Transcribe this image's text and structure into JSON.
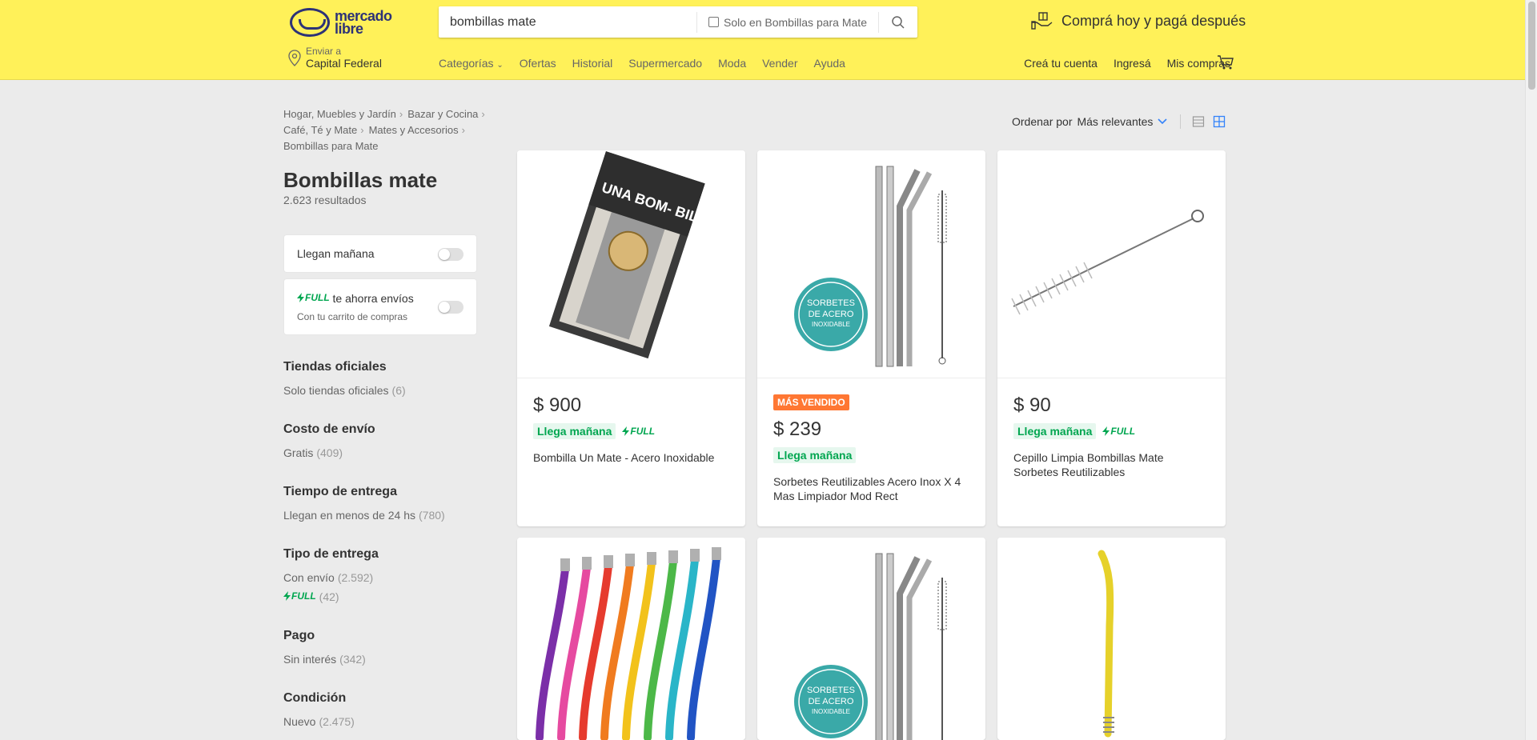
{
  "header": {
    "logo_text": "mercado libre",
    "search_value": "bombillas mate",
    "search_scope": "Solo en Bombillas para Mate",
    "promo": "Comprá hoy y pagá después",
    "location_label": "Enviar a",
    "location_value": "Capital Federal",
    "nav": [
      "Categorías",
      "Ofertas",
      "Historial",
      "Supermercado",
      "Moda",
      "Vender",
      "Ayuda"
    ],
    "user_nav": [
      "Creá tu cuenta",
      "Ingresá",
      "Mis compras"
    ],
    "colors": {
      "brand_yellow": "#fff159",
      "logo_blue": "#2d3277"
    }
  },
  "breadcrumb": [
    "Hogar, Muebles y Jardín",
    "Bazar y Cocina",
    "Café, Té y Mate",
    "Mates y Accesorios",
    "Bombillas para Mate"
  ],
  "page": {
    "title": "Bombillas mate",
    "results": "2.623 resultados"
  },
  "filters": {
    "llegan_manana": "Llegan mañana",
    "full_label": "FULL",
    "full_text": "te ahorra envíos",
    "full_sub": "Con tu carrito de compras"
  },
  "facets": [
    {
      "title": "Tiendas oficiales",
      "options": [
        {
          "label": "Solo tiendas oficiales",
          "qty": "(6)"
        }
      ]
    },
    {
      "title": "Costo de envío",
      "options": [
        {
          "label": "Gratis",
          "qty": "(409)"
        }
      ]
    },
    {
      "title": "Tiempo de entrega",
      "options": [
        {
          "label": "Llegan en menos de 24 hs",
          "qty": "(780)"
        }
      ]
    },
    {
      "title": "Tipo de entrega",
      "options": [
        {
          "label": "Con envío",
          "qty": "(2.592)"
        },
        {
          "label": "FULL",
          "qty": "(42)"
        }
      ]
    },
    {
      "title": "Pago",
      "options": [
        {
          "label": "Sin interés",
          "qty": "(342)"
        }
      ]
    },
    {
      "title": "Condición",
      "options": [
        {
          "label": "Nuevo",
          "qty": "(2.475)"
        }
      ]
    }
  ],
  "sort": {
    "label": "Ordenar por",
    "value": "Más relevantes"
  },
  "products": [
    {
      "price": "$ 900",
      "badge": "",
      "delivery": "Llega mañana",
      "full": "FULL",
      "title": "Bombilla Un Mate - Acero Inoxidable",
      "box_text": "UNA BOM- BILLA"
    },
    {
      "price": "$ 239",
      "badge": "MÁS VENDIDO",
      "delivery": "Llega mañana",
      "full": "",
      "title": "Sorbetes Reutilizables Acero Inox X 4 Mas Limpiador Mod Rect",
      "circle_text": "SORBETES DE ACERO INOXIDABLE"
    },
    {
      "price": "$ 90",
      "badge": "",
      "delivery": "Llega mañana",
      "full": "FULL",
      "title": "Cepillo Limpia Bombillas Mate Sorbetes Reutilizables"
    },
    {
      "title": ""
    },
    {
      "circle_text": "SORBETES DE ACERO INOXIDABLE"
    },
    {
      "title": ""
    }
  ]
}
